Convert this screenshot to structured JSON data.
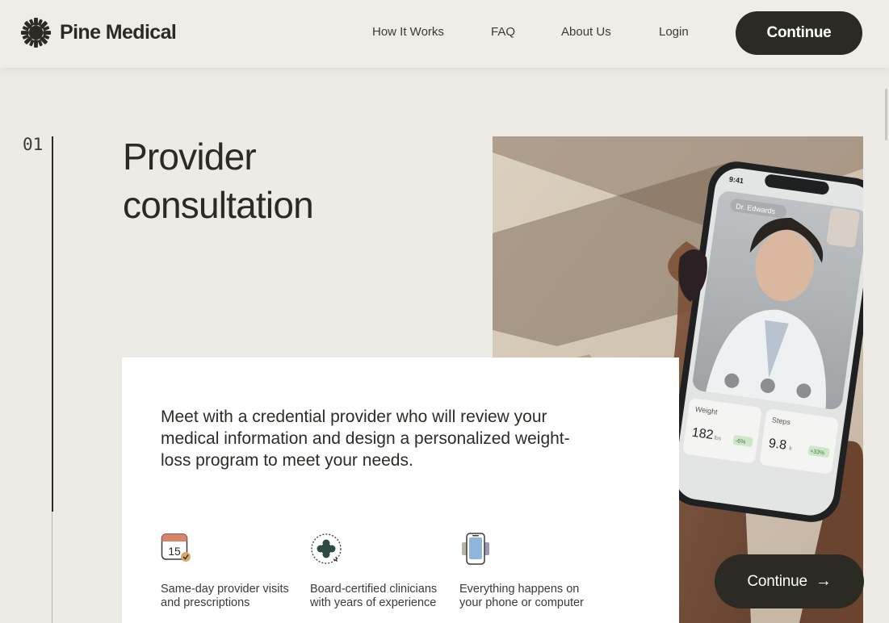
{
  "header": {
    "brand": "Pine Medical",
    "nav": [
      "How It Works",
      "FAQ",
      "About Us",
      "Login"
    ],
    "cta": "Continue"
  },
  "step": {
    "number": "01",
    "title": "Provider consultation",
    "description": "Meet with a credential provider who will review your medical information and design a personalized weight-loss program to meet your needs.",
    "features": [
      {
        "icon": "calendar-icon",
        "text": "Same-day provider visits and prescriptions"
      },
      {
        "icon": "medical-cross-icon",
        "text": "Board-certified clinicians with years of experience"
      },
      {
        "icon": "phone-icon",
        "text": "Everything happens on your phone or computer"
      }
    ]
  },
  "phone_screen": {
    "time": "9:41",
    "caller": "Dr. Edwards",
    "weight_label": "Weight",
    "weight_value": "182",
    "weight_unit": "lbs",
    "weight_change": "-6%",
    "steps_label": "Steps",
    "steps_value": "9.8",
    "steps_unit": "k",
    "steps_change": "+33%"
  },
  "floating_cta": {
    "label": "Continue",
    "arrow": "→"
  },
  "colors": {
    "background": "#edebe6",
    "dark": "#2b2a23",
    "card": "#ffffff",
    "accent_calendar": "#d98466"
  }
}
